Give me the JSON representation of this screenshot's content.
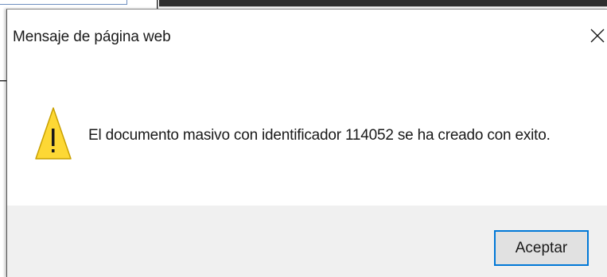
{
  "dialog": {
    "title": "Mensaje de página web",
    "message": "El documento masivo con identificador 114052 se ha creado con exito.",
    "icon": "warning-icon",
    "close_icon": "close-icon",
    "ok_label": "Aceptar"
  },
  "colors": {
    "accent": "#0078d7",
    "footer_bg": "#f0f0f0",
    "button_bg": "#e1e1e1",
    "warning_fill": "#fdd835",
    "warning_outline": "#c9a000"
  }
}
